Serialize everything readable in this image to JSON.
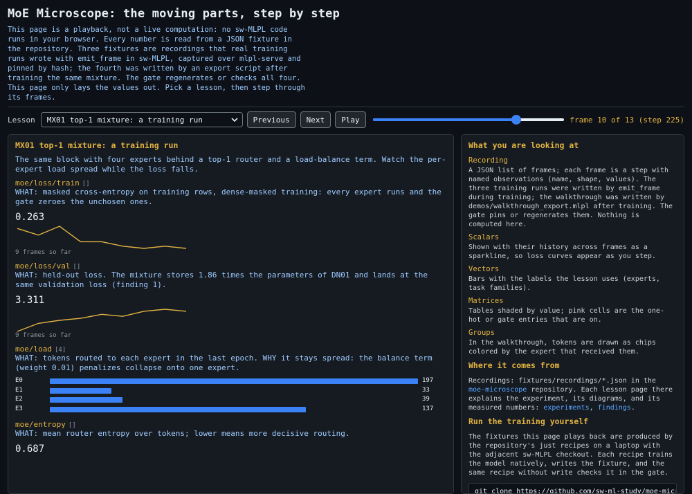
{
  "page": {
    "title": "MoE Microscope: the moving parts, step by step",
    "intro": "This page is a playback, not a live computation: no sw-MLPL code runs in your browser. Every number is read from a JSON fixture in the repository. Three fixtures are recordings that real training runs wrote with emit_frame in sw-MLPL, captured over mlpl-serve and pinned by hash; the fourth was written by an export script after training the same mixture. The gate regenerates or checks all four. This page only lays the values out. Pick a lesson, then step through its frames."
  },
  "controls": {
    "lesson_label": "Lesson",
    "lesson_selected": "MX01 top-1 mixture: a training run",
    "previous": "Previous",
    "next": "Next",
    "play": "Play",
    "slider_fraction": 0.75,
    "frame_label": "frame 10 of 13 (step 225)"
  },
  "lesson": {
    "title": "MX01 top-1 mixture: a training run",
    "description": "The same block with four experts behind a top-1 router and a load-balance term. Watch the per-expert load spread while the loss falls.",
    "observations": {
      "train": {
        "name": "moe/loss/train",
        "shape": "[]",
        "what": "WHAT: masked cross-entropy on training rows, dense-masked training: every expert runs and the gate zeroes the unchosen ones.",
        "value": "0.263",
        "history": [
          0.33,
          0.3,
          0.34,
          0.27,
          0.27,
          0.25,
          0.24,
          0.25,
          0.24
        ],
        "frames_note": "9 frames so far"
      },
      "val": {
        "name": "moe/loss/val",
        "shape": "[]",
        "what": "WHAT: held-out loss. The mixture stores 1.86 times the parameters of DN01 and lands at the same validation loss (finding 1).",
        "value": "3.311",
        "history": [
          3.13,
          3.21,
          3.24,
          3.26,
          3.3,
          3.28,
          3.33,
          3.35,
          3.33
        ],
        "frames_note": "9 frames so far"
      },
      "load": {
        "name": "moe/load",
        "shape": "[4]",
        "what": "WHAT: tokens routed to each expert in the last epoch. WHY it stays spread: the balance term (weight 0.01) penalizes collapse onto one expert.",
        "experts": [
          {
            "label": "E0",
            "value": 197
          },
          {
            "label": "E1",
            "value": 33
          },
          {
            "label": "E2",
            "value": 39
          },
          {
            "label": "E3",
            "value": 137
          }
        ]
      },
      "entropy": {
        "name": "moe/entropy",
        "shape": "[]",
        "what": "WHAT: mean router entropy over tokens; lower means more decisive routing.",
        "value": "0.687"
      }
    }
  },
  "sidebar": {
    "looking_title": "What you are looking at",
    "sections": [
      {
        "title": "Recording",
        "text": "A JSON list of frames; each frame is a step with named observations (name, shape, values). The three training runs were written by emit_frame during training; the walkthrough was written by demos/walkthrough_export.mlpl after training. The gate pins or regenerates them. Nothing is computed here."
      },
      {
        "title": "Scalars",
        "text": "Shown with their history across frames as a sparkline, so loss curves appear as you step."
      },
      {
        "title": "Vectors",
        "text": "Bars with the labels the lesson uses (experts, task families)."
      },
      {
        "title": "Matrices",
        "text": "Tables shaded by value; pink cells are the one-hot or gate entries that are on."
      },
      {
        "title": "Groups",
        "text": "In the walkthrough, tokens are drawn as chips colored by the expert that received them."
      }
    ],
    "comes_title": "Where it comes from",
    "comes_text_a": "Recordings: fixtures/recordings/*.json in the ",
    "comes_link_repo": "moe-microscope",
    "comes_text_b": " repository. Each lesson page there explains the experiment, its diagrams, and its measured numbers: ",
    "comes_link_experiments": "experiments",
    "comes_sep": ", ",
    "comes_link_findings": "findings",
    "comes_end": ".",
    "run_title": "Run the training yourself",
    "run_text": "The fixtures this page plays back are produced by the repository's just recipes on a laptop with the adjacent sw-MLPL checkout. Each recipe trains the model natively, writes the fixture, and the same recipe without write checks it in the gate.",
    "code": "git clone https://github.com/sw-ml-study/moe-microscope"
  },
  "colors": {
    "accent": "#e3b341",
    "bar": "#3b82f6",
    "link": "#58a6ff",
    "sparkline": "#e3b341"
  }
}
